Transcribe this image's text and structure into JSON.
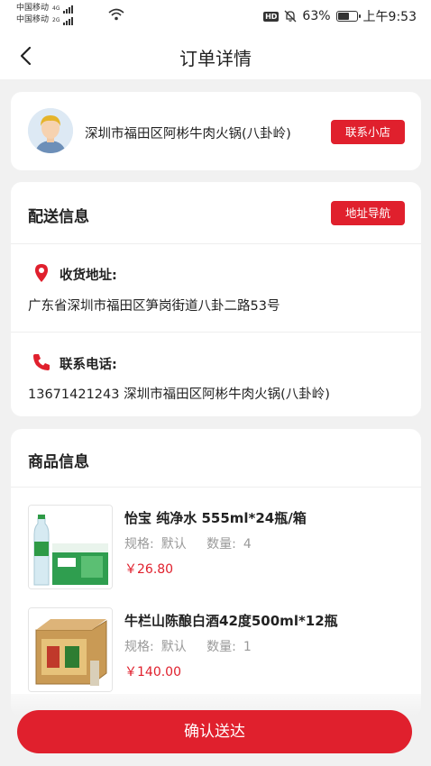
{
  "status_bar": {
    "carrier_1": "中国移动",
    "carrier_1_net": "4G",
    "carrier_2": "中国移动",
    "carrier_2_net": "2G",
    "hd": "HD",
    "battery_percent": "63%",
    "battery_level": 0.63,
    "time": "上午9:53"
  },
  "header": {
    "title": "订单详情"
  },
  "shop": {
    "name": "深圳市福田区阿彬牛肉火锅(八卦岭)",
    "contact_button": "联系小店"
  },
  "delivery": {
    "title": "配送信息",
    "nav_button": "地址导航",
    "address_label": "收货地址:",
    "address_value": "广东省深圳市福田区笋岗街道八卦二路53号",
    "phone_label": "联系电话:",
    "phone_value": "13671421243 深圳市福田区阿彬牛肉火锅(八卦岭)"
  },
  "goods": {
    "title": "商品信息",
    "items": [
      {
        "name": "怡宝 纯净水 555ml*24瓶/箱",
        "spec_label": "规格:",
        "spec_value": "默认",
        "qty_label": "数量:",
        "qty_value": "4",
        "price": "￥26.80"
      },
      {
        "name": "牛栏山陈酿白酒42度500ml*12瓶",
        "spec_label": "规格:",
        "spec_value": "默认",
        "qty_label": "数量:",
        "qty_value": "1",
        "price": "￥140.00"
      }
    ]
  },
  "footer": {
    "confirm_button": "确认送达"
  },
  "colors": {
    "accent": "#e0202d",
    "background": "#f1f1f1"
  }
}
